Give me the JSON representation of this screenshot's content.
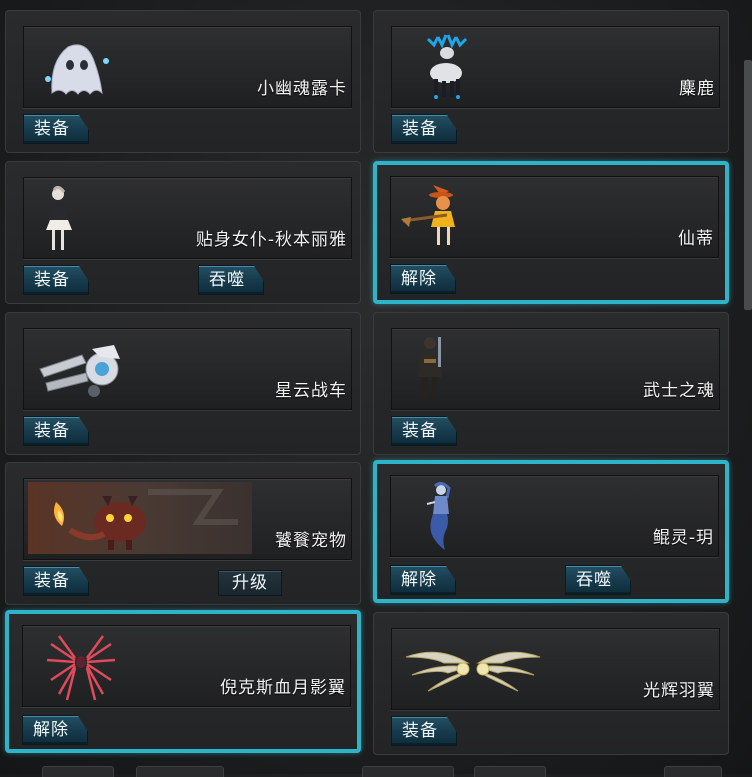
{
  "colors": {
    "selected_border": "#2fb3c8",
    "button_bg": "#1a4255",
    "text": "#f2f2f2"
  },
  "cards": [
    {
      "name": "小幽魂露卡",
      "icon": "ghost-pet-icon",
      "selected": false,
      "buttons": [
        "装备"
      ]
    },
    {
      "name": "麋鹿",
      "icon": "elk-pet-icon",
      "selected": false,
      "buttons": [
        "装备"
      ]
    },
    {
      "name": "贴身女仆-秋本丽雅",
      "icon": "maid-pet-icon",
      "selected": false,
      "buttons": [
        "装备",
        "吞噬"
      ]
    },
    {
      "name": "仙蒂",
      "icon": "witch-pet-icon",
      "selected": true,
      "buttons": [
        "解除"
      ]
    },
    {
      "name": "星云战车",
      "icon": "chariot-pet-icon",
      "selected": false,
      "buttons": [
        "装备"
      ]
    },
    {
      "name": "武士之魂",
      "icon": "samurai-pet-icon",
      "selected": false,
      "buttons": [
        "装备"
      ]
    },
    {
      "name": "饕餮宠物",
      "icon": "taotie-pet-icon",
      "selected": false,
      "buttons": [
        "装备",
        "升级"
      ]
    },
    {
      "name": "鲲灵-玥",
      "icon": "mermaid-pet-icon",
      "selected": true,
      "buttons": [
        "解除",
        "吞噬"
      ]
    },
    {
      "name": "倪克斯血月影翼",
      "icon": "blood-wings-icon",
      "selected": true,
      "buttons": [
        "解除"
      ]
    },
    {
      "name": "光辉羽翼",
      "icon": "radiant-wings-icon",
      "selected": false,
      "buttons": [
        "装备"
      ]
    }
  ]
}
